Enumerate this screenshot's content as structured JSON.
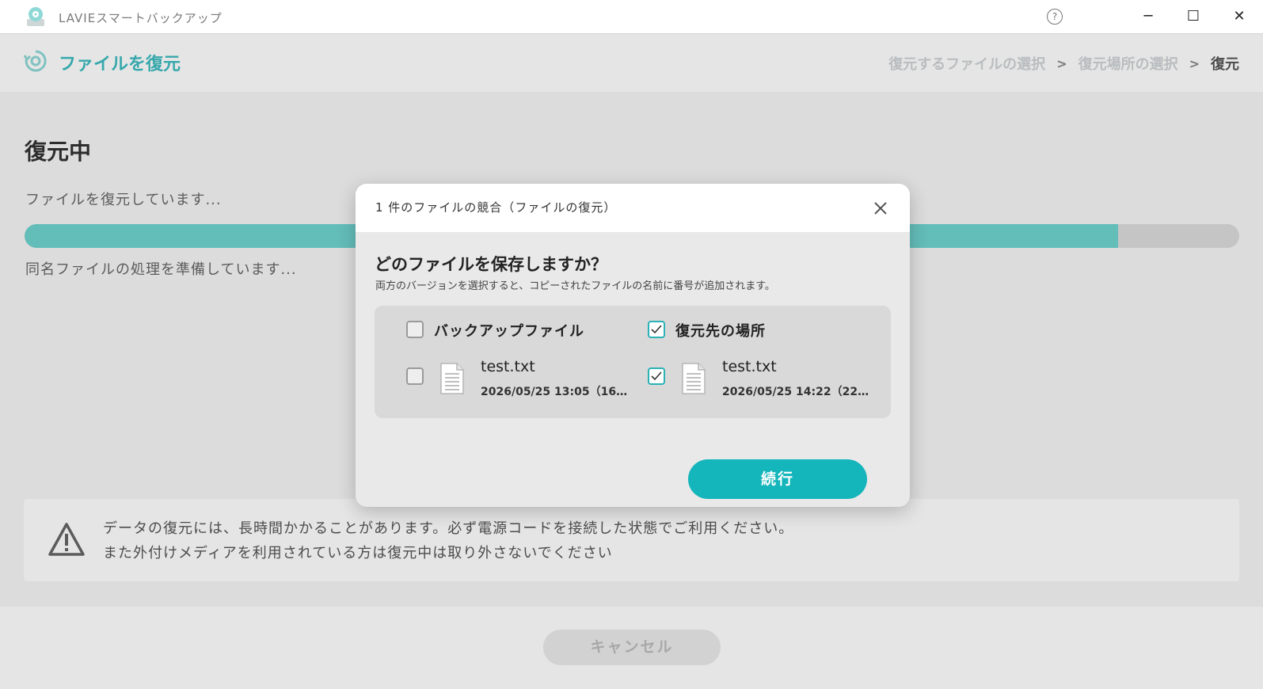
{
  "app": {
    "title": "LAVIEスマートバックアップ"
  },
  "header": {
    "title": "ファイルを復元",
    "breadcrumb": [
      "復元するファイルの選択",
      "復元場所の選択",
      "復元"
    ]
  },
  "main": {
    "title": "復元中",
    "status1": "ファイルを復元しています...",
    "progress": 0.9,
    "status2": "同名ファイルの処理を準備しています...",
    "notice_line1": "データの復元には、長時間かかることがあります。必ず電源コードを接続した状態でご利用ください。",
    "notice_line2": "また外付けメディアを利用されている方は復元中は取り外さないでください"
  },
  "footer": {
    "cancel_label": "キャンセル"
  },
  "dialog": {
    "title": "1 件のファイルの競合（ファイルの復元）",
    "question": "どのファイルを保存しますか？",
    "subtitle": "両方のバージョンを選択すると、コピーされたファイルの名前に番号が追加されます。",
    "columns": [
      {
        "label": "バックアップファイル",
        "checked": false,
        "file_name": "test.txt",
        "file_meta": "2026/05/25 13:05（16…",
        "file_checked": false
      },
      {
        "label": "復元先の場所",
        "checked": true,
        "file_name": "test.txt",
        "file_meta": "2026/05/25 14:22（22…",
        "file_checked": true
      }
    ],
    "continue_label": "続行"
  },
  "colors": {
    "accent": "#14b5bb",
    "progress": "#6fd3cf"
  },
  "icons": {
    "app": "app-disk-icon",
    "restore": "restore-icon",
    "help": "help-icon",
    "warning": "warning-icon",
    "file": "text-file-icon"
  }
}
